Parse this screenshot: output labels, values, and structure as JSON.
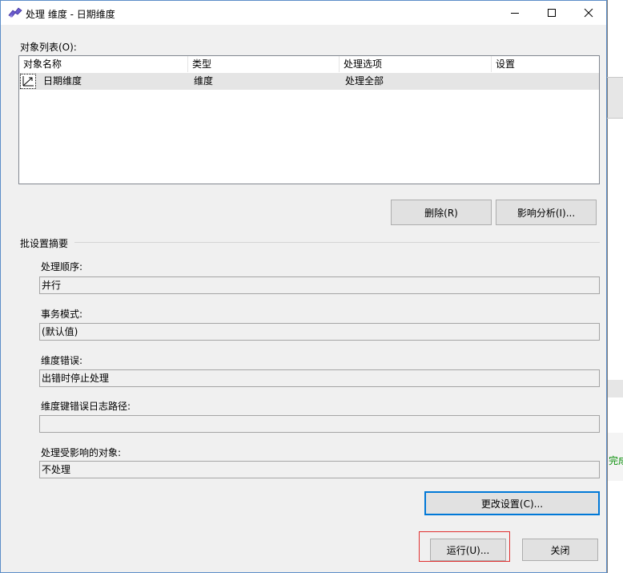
{
  "window": {
    "title": "处理 维度 - 日期维度"
  },
  "object_list": {
    "label": "对象列表(O):",
    "columns": [
      "对象名称",
      "类型",
      "处理选项",
      "设置"
    ],
    "rows": [
      {
        "name": "日期维度",
        "type": "维度",
        "option": "处理全部",
        "setting": ""
      }
    ]
  },
  "list_buttons": {
    "delete": "删除(R)",
    "impact": "影响分析(I)..."
  },
  "batch": {
    "group_label": "批设置摘要",
    "order_label": "处理顺序:",
    "order_value": "并行",
    "transaction_label": "事务模式:",
    "transaction_value": "(默认值)",
    "dim_error_label": "维度错误:",
    "dim_error_value": "出错时停止处理",
    "key_error_log_label": "维度键错误日志路径:",
    "key_error_log_value": "",
    "affected_label": "处理受影响的对象:",
    "affected_value": "不处理",
    "change_settings": "更改设置(C)..."
  },
  "footer": {
    "run": "运行(U)...",
    "close": "关闭"
  },
  "background": {
    "partial_text": "完成"
  },
  "colors": {
    "accent": "#0078d7",
    "highlight_box": "#e03030",
    "selected_row": "#e5e5e5"
  }
}
